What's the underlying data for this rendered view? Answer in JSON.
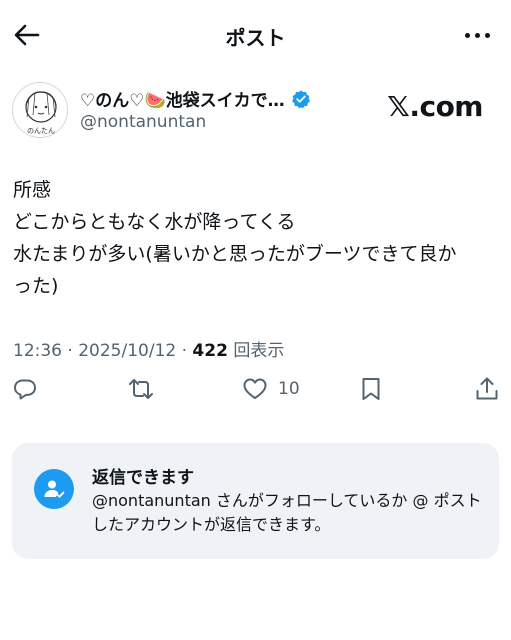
{
  "header": {
    "title": "ポスト",
    "back_icon": "arrow-left-icon",
    "more_icon": "more-horizontal-icon"
  },
  "author": {
    "display_name": "♡のん♡🍉池袋スイカで…",
    "handle": "@nontanuntan",
    "avatar_text": "のんたん",
    "verified_color": "#1d9bf0"
  },
  "source_label": "𝕏.com",
  "post": {
    "lines": [
      "所感",
      "どこからともなく水が降ってくる",
      "水たまりが多い(暑いかと思ったがブーツできて良か",
      "った)"
    ]
  },
  "meta": {
    "time": "12:36",
    "date": "2025/10/12",
    "views_count": "422",
    "views_label": "回表示"
  },
  "actions": {
    "reply_icon": "reply-icon",
    "repost_icon": "repost-icon",
    "like_icon": "heart-icon",
    "like_count": "10",
    "bookmark_icon": "bookmark-icon",
    "share_icon": "share-icon"
  },
  "reply_restriction": {
    "title": "返信できます",
    "body": "@nontanuntan さんがフォローしているか @ ポストしたアカウントが返信できます。",
    "icon_color": "#1d9bf0"
  }
}
